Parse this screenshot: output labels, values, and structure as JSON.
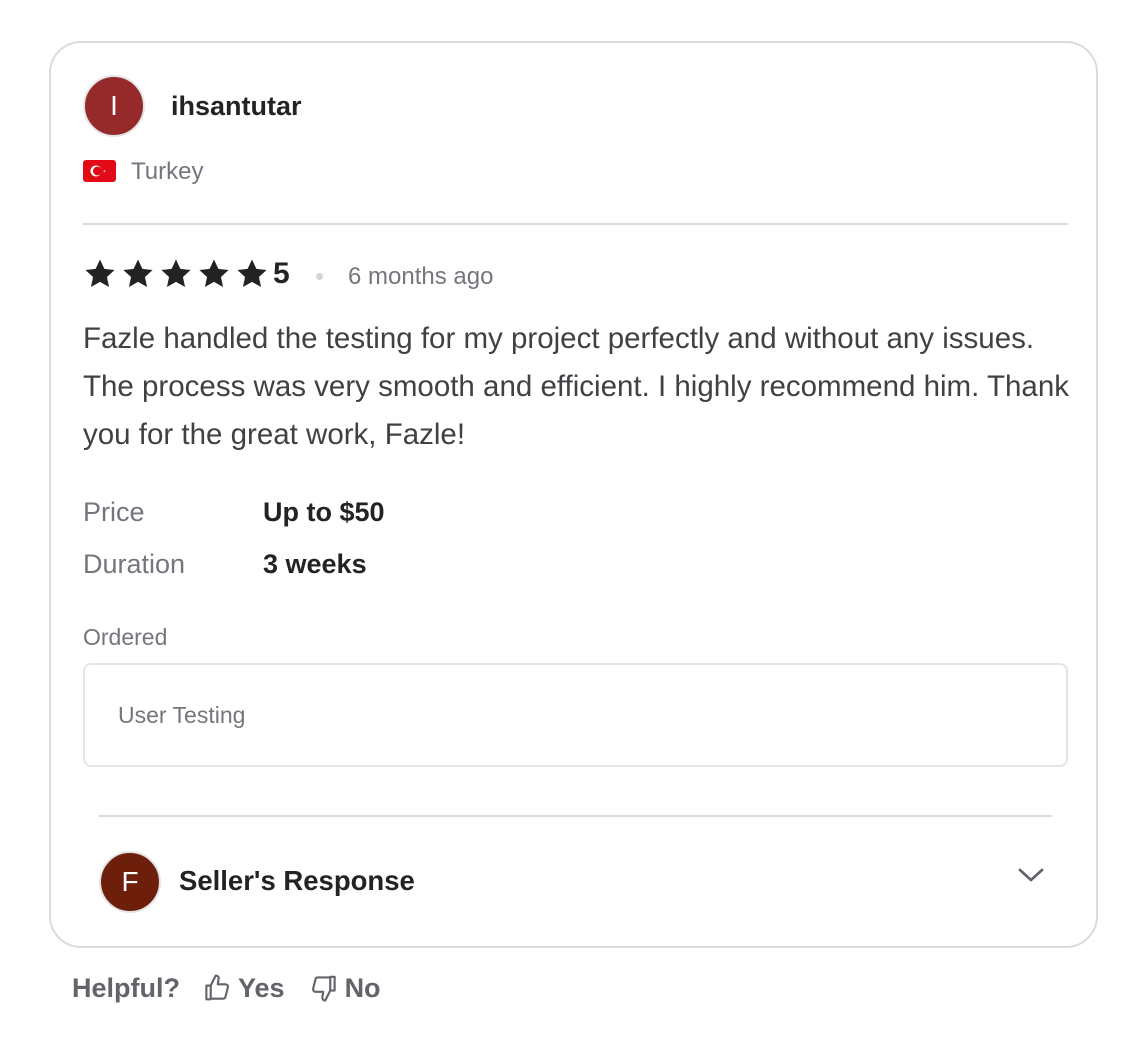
{
  "review": {
    "avatar_letter": "I",
    "avatar_color": "#962a2a",
    "username": "ihsantutar",
    "country": "Turkey",
    "country_flag_icon": "turkey-flag-icon",
    "rating": "5",
    "star_count": 5,
    "time_ago": "6 months ago",
    "text": "Fazle handled the testing for my project perfectly and without any issues. The process was very smooth and efficient. I highly recommend him. Thank you for the great work, Fazle!",
    "price_label": "Price",
    "price_value": "Up to $50",
    "duration_label": "Duration",
    "duration_value": "3 weeks",
    "ordered_label": "Ordered",
    "ordered_item": "User Testing"
  },
  "seller_response": {
    "avatar_letter": "F",
    "avatar_color": "#6e1f0c",
    "title": "Seller's Response",
    "expand_icon": "chevron-down-icon"
  },
  "helpful": {
    "label": "Helpful?",
    "yes_label": "Yes",
    "no_label": "No",
    "yes_icon": "thumbs-up-icon",
    "no_icon": "thumbs-down-icon"
  },
  "colors": {
    "star": "#222325",
    "text_primary": "#222325",
    "text_secondary": "#74767e",
    "border": "#dadbdd",
    "flag_red": "#e30a17"
  }
}
